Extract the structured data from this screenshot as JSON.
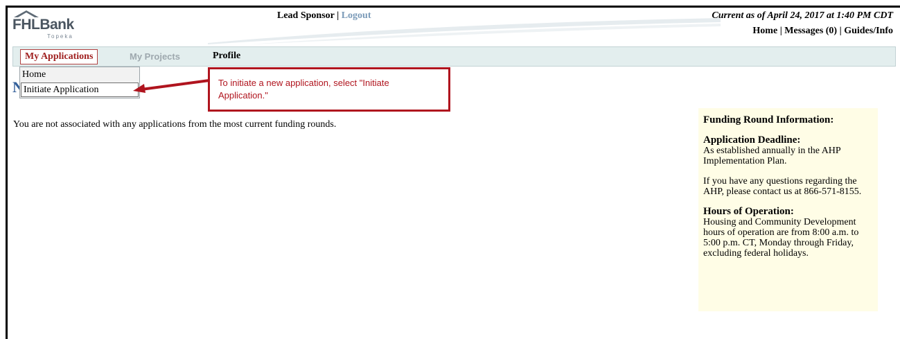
{
  "header": {
    "logo_text": "FHLBank",
    "logo_sub": "Topeka",
    "user_role": "Lead Sponsor",
    "separator": " | ",
    "logout_label": "Logout",
    "current_as_of": "Current as of April 24, 2017 at 1:40 PM CDT",
    "links": {
      "home": "Home",
      "messages": "Messages (0)",
      "guides": "Guides/Info"
    }
  },
  "nav": {
    "my_applications": "My Applications",
    "my_projects": "My Projects",
    "profile": "Profile"
  },
  "dropdown": {
    "items": [
      "Home",
      "Initiate Application"
    ]
  },
  "page_title_visible": "N",
  "callout": {
    "text": "To initiate a new application, select \"Initiate Application.\""
  },
  "main": {
    "message": "You are not associated with any applications from the most current funding rounds."
  },
  "info_panel": {
    "title": "Funding Round Information:",
    "deadline_heading": "Application Deadline:",
    "deadline_text": "As established annually in the AHP Implementation Plan.",
    "questions_text": "If you have any questions regarding the AHP, please contact us at 866-571-8155.",
    "hours_heading": "Hours of Operation:",
    "hours_text": "Housing and Community Development hours of operation are from 8:00 a.m. to 5:00 p.m. CT, Monday through Friday, excluding federal holidays."
  },
  "colors": {
    "nav_bg": "#e3eeee",
    "callout_red": "#b0141e",
    "info_bg": "#fffde6",
    "logout_blue": "#7a9ab8"
  }
}
